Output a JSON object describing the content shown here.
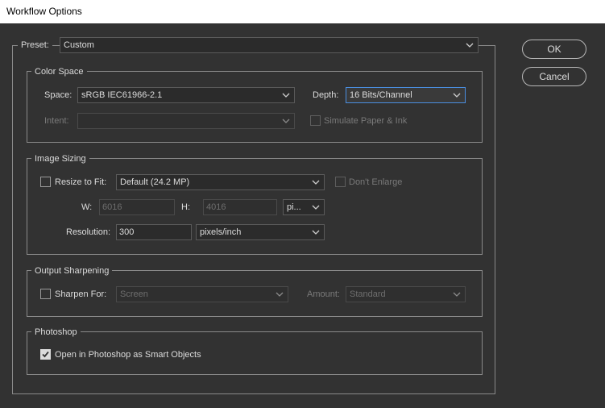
{
  "window": {
    "title": "Workflow Options"
  },
  "preset": {
    "label": "Preset:",
    "value": "Custom"
  },
  "color_space": {
    "legend": "Color Space",
    "space_label": "Space:",
    "space_value": "sRGB IEC61966-2.1",
    "depth_label": "Depth:",
    "depth_value": "16 Bits/Channel",
    "intent_label": "Intent:",
    "intent_value": "",
    "simulate_label": "Simulate Paper & Ink"
  },
  "image_sizing": {
    "legend": "Image Sizing",
    "resize_label": "Resize to Fit:",
    "resize_value": "Default  (24.2 MP)",
    "dont_enlarge_label": "Don't Enlarge",
    "w_label": "W:",
    "w_value": "6016",
    "h_label": "H:",
    "h_value": "4016",
    "unit_value": "pi...",
    "resolution_label": "Resolution:",
    "resolution_value": "300",
    "resolution_unit": "pixels/inch"
  },
  "output_sharpening": {
    "legend": "Output Sharpening",
    "sharpen_label": "Sharpen For:",
    "sharpen_value": "Screen",
    "amount_label": "Amount:",
    "amount_value": "Standard"
  },
  "photoshop": {
    "legend": "Photoshop",
    "smart_objects_label": "Open in Photoshop as Smart Objects",
    "smart_objects_checked": true
  },
  "buttons": {
    "ok": "OK",
    "cancel": "Cancel"
  }
}
